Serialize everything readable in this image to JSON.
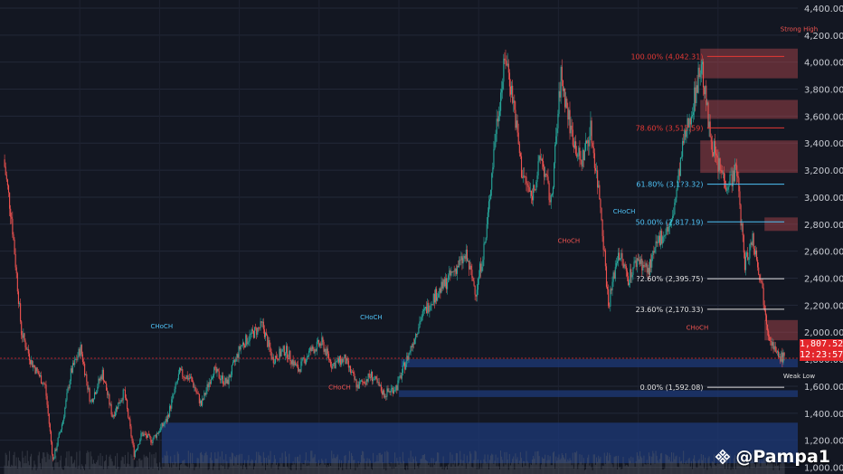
{
  "watermark": {
    "text": "@Pampa1",
    "icon": "binance-diamond-icon"
  },
  "price_axis": {
    "ticks": [
      "4,400.00",
      "4,200.00",
      "4,000.00",
      "3,800.00",
      "3,600.00",
      "3,400.00",
      "3,200.00",
      "3,000.00",
      "2,800.00",
      "2,600.00",
      "2,400.00",
      "2,200.00",
      "2,000.00",
      "1,800.00",
      "1,600.00",
      "1,400.00",
      "1,200.00",
      "1,000.00"
    ],
    "last_price": "1,807.52",
    "countdown": "12:23:57"
  },
  "colors": {
    "background": "#131722",
    "up": "#26a69a",
    "down": "#ef5350",
    "fib_red": "#e53935",
    "fib_blue": "#4fc3f7",
    "fib_white": "#e0e0e0",
    "demand_zone": "#1e3a78",
    "supply_zone": "#b84a4f",
    "price_tag": "#e3262b"
  },
  "chart_data": {
    "type": "candlestick",
    "ylim": [
      950,
      4460
    ],
    "y_ticks": [
      4400,
      4200,
      4000,
      3800,
      3600,
      3400,
      3200,
      3000,
      2800,
      2600,
      2400,
      2200,
      2000,
      1800,
      1600,
      1400,
      1200,
      1000
    ],
    "last_price": 1807.52,
    "countdown": "12:23:57",
    "close_path": [
      {
        "bar": 0,
        "close": 3280
      },
      {
        "bar": 8,
        "close": 2850
      },
      {
        "bar": 18,
        "close": 2000
      },
      {
        "bar": 28,
        "close": 1780
      },
      {
        "bar": 42,
        "close": 1600
      },
      {
        "bar": 50,
        "close": 1050
      },
      {
        "bar": 60,
        "close": 1350
      },
      {
        "bar": 68,
        "close": 1700
      },
      {
        "bar": 78,
        "close": 1880
      },
      {
        "bar": 88,
        "close": 1480
      },
      {
        "bar": 100,
        "close": 1700
      },
      {
        "bar": 110,
        "close": 1380
      },
      {
        "bar": 122,
        "close": 1560
      },
      {
        "bar": 132,
        "close": 1100
      },
      {
        "bar": 140,
        "close": 1250
      },
      {
        "bar": 150,
        "close": 1200
      },
      {
        "bar": 165,
        "close": 1350
      },
      {
        "bar": 178,
        "close": 1700
      },
      {
        "bar": 190,
        "close": 1650
      },
      {
        "bar": 200,
        "close": 1460
      },
      {
        "bar": 212,
        "close": 1720
      },
      {
        "bar": 226,
        "close": 1620
      },
      {
        "bar": 240,
        "close": 1900
      },
      {
        "bar": 252,
        "close": 1990
      },
      {
        "bar": 262,
        "close": 2050
      },
      {
        "bar": 272,
        "close": 1800
      },
      {
        "bar": 285,
        "close": 1870
      },
      {
        "bar": 298,
        "close": 1720
      },
      {
        "bar": 310,
        "close": 1860
      },
      {
        "bar": 322,
        "close": 1920
      },
      {
        "bar": 332,
        "close": 1760
      },
      {
        "bar": 345,
        "close": 1800
      },
      {
        "bar": 358,
        "close": 1600
      },
      {
        "bar": 372,
        "close": 1680
      },
      {
        "bar": 385,
        "close": 1540
      },
      {
        "bar": 398,
        "close": 1600
      },
      {
        "bar": 410,
        "close": 1840
      },
      {
        "bar": 422,
        "close": 2100
      },
      {
        "bar": 434,
        "close": 2250
      },
      {
        "bar": 446,
        "close": 2350
      },
      {
        "bar": 458,
        "close": 2480
      },
      {
        "bar": 468,
        "close": 2560
      },
      {
        "bar": 478,
        "close": 2300
      },
      {
        "bar": 488,
        "close": 2700
      },
      {
        "bar": 498,
        "close": 3500
      },
      {
        "bar": 508,
        "close": 4050
      },
      {
        "bar": 516,
        "close": 3700
      },
      {
        "bar": 524,
        "close": 3200
      },
      {
        "bar": 534,
        "close": 3000
      },
      {
        "bar": 544,
        "close": 3300
      },
      {
        "bar": 554,
        "close": 2950
      },
      {
        "bar": 564,
        "close": 3900
      },
      {
        "bar": 574,
        "close": 3500
      },
      {
        "bar": 584,
        "close": 3250
      },
      {
        "bar": 594,
        "close": 3500
      },
      {
        "bar": 604,
        "close": 2950
      },
      {
        "bar": 612,
        "close": 2200
      },
      {
        "bar": 622,
        "close": 2600
      },
      {
        "bar": 632,
        "close": 2400
      },
      {
        "bar": 642,
        "close": 2550
      },
      {
        "bar": 652,
        "close": 2450
      },
      {
        "bar": 664,
        "close": 2700
      },
      {
        "bar": 676,
        "close": 2800
      },
      {
        "bar": 688,
        "close": 3400
      },
      {
        "bar": 698,
        "close": 3700
      },
      {
        "bar": 706,
        "close": 4000
      },
      {
        "bar": 714,
        "close": 3500
      },
      {
        "bar": 722,
        "close": 3250
      },
      {
        "bar": 732,
        "close": 3100
      },
      {
        "bar": 742,
        "close": 3200
      },
      {
        "bar": 750,
        "close": 2500
      },
      {
        "bar": 758,
        "close": 2700
      },
      {
        "bar": 766,
        "close": 2400
      },
      {
        "bar": 774,
        "close": 2000
      },
      {
        "bar": 782,
        "close": 1830
      },
      {
        "bar": 790,
        "close": 1807.52
      }
    ],
    "fibonacci": [
      {
        "label": "100.00% (4,042.31)",
        "price": 4042.31,
        "color": "fib_red"
      },
      {
        "label": "78.60% (3,512.59)",
        "price": 3512.59,
        "color": "fib_red"
      },
      {
        "label": "61.80% (3,1?3.32)",
        "price": 3096.32,
        "color": "fib_blue"
      },
      {
        "label": "50.00% (2,817.19)",
        "price": 2817.19,
        "color": "fib_blue"
      },
      {
        "label": "?2.60% (2,395.75)",
        "price": 2395.75,
        "color": "fib_white"
      },
      {
        "label": "23.60% (2,170.33)",
        "price": 2170.33,
        "color": "fib_white"
      },
      {
        "label": "0.00% (1,592.08)",
        "price": 1592.08,
        "color": "fib_white"
      }
    ],
    "zones": [
      {
        "kind": "supply",
        "top": 4100,
        "bottom": 3880
      },
      {
        "kind": "supply",
        "top": 3720,
        "bottom": 3580
      },
      {
        "kind": "supply",
        "top": 3420,
        "bottom": 3180
      },
      {
        "kind": "supply",
        "top": 2850,
        "bottom": 2750
      },
      {
        "kind": "supply",
        "top": 2090,
        "bottom": 1940
      },
      {
        "kind": "demand",
        "top": 1800,
        "bottom": 1740
      },
      {
        "kind": "demand",
        "top": 1570,
        "bottom": 1520
      },
      {
        "kind": "demand",
        "top": 1330,
        "bottom": 1030
      }
    ],
    "structure_labels": [
      {
        "text": "CHoCH",
        "bar": 160,
        "price": 2030,
        "color": "fib_blue"
      },
      {
        "text": "CHoCH",
        "bar": 372,
        "price": 2095,
        "color": "fib_blue"
      },
      {
        "text": "CHoCH",
        "bar": 340,
        "price": 1575,
        "color": "down"
      },
      {
        "text": "CHoCH",
        "bar": 572,
        "price": 2660,
        "color": "down"
      },
      {
        "text": "CHoCH",
        "bar": 628,
        "price": 2880,
        "color": "fib_blue"
      },
      {
        "text": "CHoCH",
        "bar": 702,
        "price": 2020,
        "color": "down"
      },
      {
        "text": "Strong High",
        "bar": 805,
        "price": 4230,
        "color": "down"
      },
      {
        "text": "Weak Low",
        "bar": 805,
        "price": 1660,
        "color": "fib_white"
      }
    ]
  }
}
